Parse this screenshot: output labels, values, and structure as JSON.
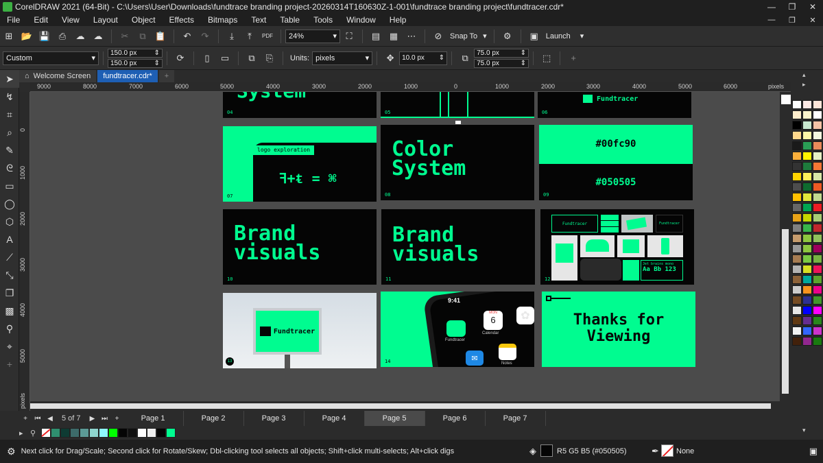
{
  "window": {
    "title": "CorelDRAW 2021 (64-Bit) - C:\\Users\\User\\Downloads\\fundtrace branding project-20260314T160630Z-1-001\\fundtrace branding project\\fundtracer.cdr*"
  },
  "menu": [
    "File",
    "Edit",
    "View",
    "Layout",
    "Object",
    "Effects",
    "Bitmaps",
    "Text",
    "Table",
    "Tools",
    "Window",
    "Help"
  ],
  "toolbar": {
    "zoom": "24%",
    "snap_to": "Snap To",
    "launch": "Launch"
  },
  "propertybar": {
    "preset": "Custom",
    "width": "150.0 px",
    "height": "150.0 px",
    "units_label": "Units:",
    "units": "pixels",
    "nudge": "10.0 px",
    "dup_x": "75.0 px",
    "dup_y": "75.0 px"
  },
  "doc_tabs": {
    "welcome": "Welcome Screen",
    "active": "fundtracer.cdr*"
  },
  "hruler": {
    "ticks": [
      "9000",
      "8000",
      "7000",
      "6000",
      "5000",
      "4000",
      "3000",
      "2000",
      "1000",
      "0",
      "1000",
      "2000",
      "3000",
      "4000",
      "5000",
      "6000"
    ],
    "unit": "pixels"
  },
  "vruler": {
    "ticks": [
      "0",
      "1000",
      "2000",
      "3000",
      "4000",
      "5000"
    ],
    "unit": "pixels"
  },
  "slides": {
    "s04": {
      "num": "04",
      "title": "System"
    },
    "s05": {
      "num": "05"
    },
    "s06": {
      "num": "06",
      "brand": "Fundtracer"
    },
    "s07": {
      "num": "07",
      "label": "logo exploration",
      "formula": "ꟻ+ᵵ = ⌘"
    },
    "s08": {
      "num": "08",
      "title_line1": "Color",
      "title_line2": "System"
    },
    "s09": {
      "num": "09",
      "hex1": "#00fc90",
      "hex2": "#050505"
    },
    "s10": {
      "num": "10",
      "line1": "Brand",
      "line2": "visuals"
    },
    "s11": {
      "num": "11",
      "line1": "Brand",
      "line2": "visuals"
    },
    "s12": {
      "num": "12",
      "brand": "Fundtracer",
      "font_name": "Jet brains mono",
      "font_sample": "Aa Bb 123"
    },
    "s13": {
      "num": "13",
      "brand": "Fundtracer"
    },
    "s14": {
      "num": "14",
      "time": "9:41",
      "day": "MON",
      "date": "6",
      "cal": "Calendar",
      "app": "Fundtracer",
      "notes": "Notes"
    },
    "s15": {
      "line1": "Thanks for",
      "line2": "Viewing"
    }
  },
  "page_nav": {
    "info": "5 of 7",
    "pages": [
      "Page 1",
      "Page 2",
      "Page 3",
      "Page 4",
      "Page 5",
      "Page 6",
      "Page 7"
    ],
    "active": "Page 5"
  },
  "doc_palette": [
    "#2f8f6f",
    "#0e3b33",
    "#3d6b6a",
    "#5c9a96",
    "#8fd6cf",
    "#8ff8ff",
    "#00ff00",
    "#050505",
    "#111111",
    "#ffffff",
    "#f0f0f0",
    "#050505",
    "#00fc90"
  ],
  "status": {
    "hint": "Next click for Drag/Scale; Second click for Rotate/Skew; Dbl-clicking tool selects all objects; Shift+click multi-selects; Alt+click digs",
    "fill": "R5 G5 B5 (#050505)",
    "outline": "None"
  },
  "palette_colors": [
    "#ffffff",
    "#fde9e5",
    "#ffe6d9",
    "#ffeecc",
    "#fbf4cc",
    "#ffffff",
    "#000000",
    "#c8e8cf",
    "#f5c3a6",
    "#ffd88c",
    "#fef7a7",
    "#f5f9e0",
    "#1a1a1a",
    "#2a9d55",
    "#e98a5b",
    "#fcb03b",
    "#fff200",
    "#e6f0c5",
    "#333333",
    "#1e7b3c",
    "#f47735",
    "#ffd400",
    "#fdf05a",
    "#d8e8a8",
    "#4d4d4d",
    "#0e6b2f",
    "#ee5a24",
    "#ffc000",
    "#e0e63b",
    "#c1da8f",
    "#666666",
    "#00a651",
    "#ed1c24",
    "#e8a317",
    "#c4d600",
    "#a8cd74",
    "#808080",
    "#39b54a",
    "#c1272d",
    "#c69c6d",
    "#8dc63f",
    "#8fc15b",
    "#999999",
    "#8cc63f",
    "#9e005d",
    "#a67c52",
    "#7ac943",
    "#76b442",
    "#b3b3b3",
    "#d7df23",
    "#ed145b",
    "#8c6239",
    "#00a99d",
    "#5ca52c",
    "#cccccc",
    "#f7941e",
    "#ec008c",
    "#754c24",
    "#2e3192",
    "#42972a",
    "#e6e6e6",
    "#0000ff",
    "#ff00ff",
    "#603913",
    "#662d91",
    "#29881c",
    "#f2f2f2",
    "#3366ff",
    "#cc33cc",
    "#42210b",
    "#92278f",
    "#1a7a10"
  ]
}
